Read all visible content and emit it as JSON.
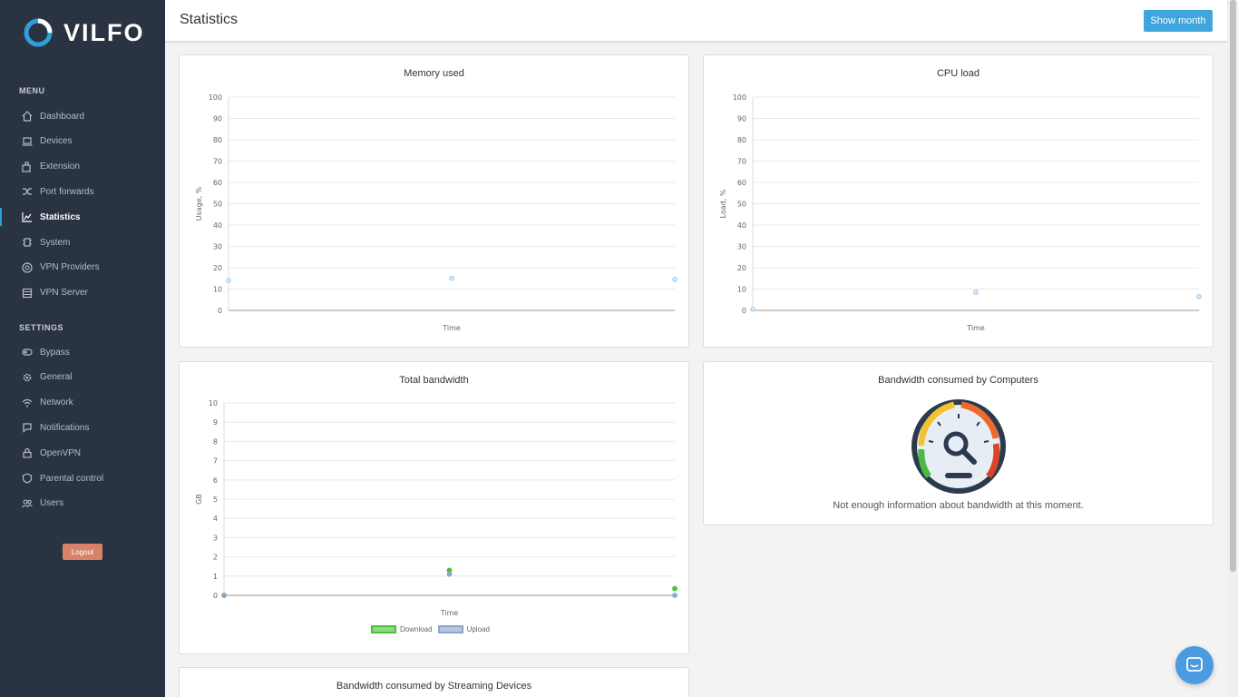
{
  "brand": {
    "name": "VILFO",
    "accent": "#2f9fd8"
  },
  "sidebar": {
    "menu_title": "MENU",
    "settings_title": "SETTINGS",
    "menu_items": [
      {
        "label": "Dashboard",
        "icon": "home-icon"
      },
      {
        "label": "Devices",
        "icon": "laptop-icon"
      },
      {
        "label": "Extension",
        "icon": "extension-icon"
      },
      {
        "label": "Port forwards",
        "icon": "shuffle-icon"
      },
      {
        "label": "Statistics",
        "icon": "chart-icon",
        "active": true
      },
      {
        "label": "System",
        "icon": "chip-icon"
      },
      {
        "label": "VPN Providers",
        "icon": "vpn-icon"
      },
      {
        "label": "VPN Server",
        "icon": "server-icon"
      }
    ],
    "settings_items": [
      {
        "label": "Bypass",
        "icon": "toggle-icon"
      },
      {
        "label": "General",
        "icon": "gear-icon"
      },
      {
        "label": "Network",
        "icon": "wifi-icon"
      },
      {
        "label": "Notifications",
        "icon": "chat-icon"
      },
      {
        "label": "OpenVPN",
        "icon": "lock-icon"
      },
      {
        "label": "Parental control",
        "icon": "shield-icon"
      },
      {
        "label": "Users",
        "icon": "users-icon"
      }
    ],
    "logout_label": "Logout"
  },
  "header": {
    "title": "Statistics",
    "show_month_label": "Show month"
  },
  "cards": {
    "memory_title": "Memory used",
    "cpu_title": "CPU load",
    "bandwidth_title": "Total bandwidth",
    "computers_title": "Bandwidth consumed by Computers",
    "computers_message": "Not enough information about bandwidth at this moment.",
    "streaming_title": "Bandwidth consumed by Streaming Devices"
  },
  "chart_data": [
    {
      "type": "scatter",
      "title": "Memory used",
      "xlabel": "Time",
      "ylabel": "Usage, %",
      "ylim": [
        0,
        100
      ],
      "yticks": [
        0,
        10,
        20,
        30,
        40,
        50,
        60,
        70,
        80,
        90,
        100
      ],
      "x": [
        0,
        1,
        2
      ],
      "series": [
        {
          "values": [
            14,
            15,
            14.5
          ],
          "color": "#a8d0f0"
        }
      ]
    },
    {
      "type": "scatter",
      "title": "CPU load",
      "xlabel": "Time",
      "ylabel": "Load, %",
      "ylim": [
        0,
        100
      ],
      "yticks": [
        0,
        10,
        20,
        30,
        40,
        50,
        60,
        70,
        80,
        90,
        100
      ],
      "x": [
        0,
        1,
        2
      ],
      "series": [
        {
          "values": [
            0.5,
            8.5,
            6.5
          ],
          "color": "#a8d0f0"
        }
      ]
    },
    {
      "type": "scatter",
      "title": "Total bandwidth",
      "xlabel": "Time",
      "ylabel": "GB",
      "ylim": [
        0,
        10
      ],
      "yticks": [
        0,
        1,
        2,
        3,
        4,
        5,
        6,
        7,
        8,
        9,
        10
      ],
      "x": [
        0,
        1,
        2
      ],
      "series": [
        {
          "name": "Download",
          "values": [
            0,
            1.3,
            0.35
          ],
          "color": "#4cbf3a"
        },
        {
          "name": "Upload",
          "values": [
            0,
            1.1,
            0
          ],
          "color": "#8aa6c8"
        }
      ]
    }
  ]
}
